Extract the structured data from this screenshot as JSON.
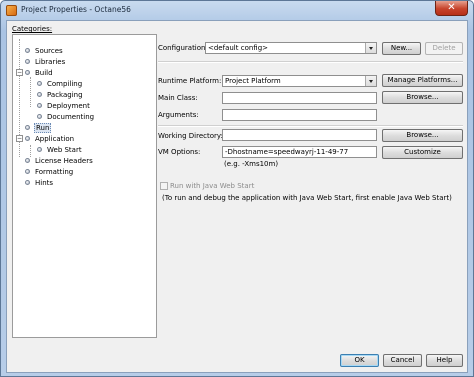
{
  "window": {
    "title": "Project Properties - Octane56",
    "close_glyph": "✕"
  },
  "categories": {
    "label": "Categories:",
    "items": [
      {
        "label": "Sources"
      },
      {
        "label": "Libraries"
      },
      {
        "label": "Build",
        "toggle": "−"
      },
      {
        "label": "Compiling"
      },
      {
        "label": "Packaging"
      },
      {
        "label": "Deployment"
      },
      {
        "label": "Documenting"
      },
      {
        "label": "Run",
        "selected": true
      },
      {
        "label": "Application",
        "toggle": "−"
      },
      {
        "label": "Web Start"
      },
      {
        "label": "License Headers"
      },
      {
        "label": "Formatting"
      },
      {
        "label": "Hints"
      }
    ]
  },
  "configuration": {
    "label": "Configuration:",
    "value": "<default config>",
    "new_button": "New...",
    "delete_button": "Delete"
  },
  "runtime_platform": {
    "label": "Runtime Platform:",
    "value": "Project Platform",
    "manage_button": "Manage Platforms..."
  },
  "main_class": {
    "label": "Main Class:",
    "value": "",
    "browse_button": "Browse..."
  },
  "arguments": {
    "label": "Arguments:",
    "value": ""
  },
  "working_directory": {
    "label": "Working Directory:",
    "value": "",
    "browse_button": "Browse..."
  },
  "vm_options": {
    "label": "VM Options:",
    "value": "-Dhostname=speedwayrj-11-49-77",
    "hint": "(e.g. -Xms10m)",
    "customize_button": "Customize"
  },
  "web_start": {
    "checkbox_label": "Run with Java Web Start",
    "note": "(To run and debug the application with Java Web Start, first enable Java Web Start)"
  },
  "footer": {
    "ok_button": "OK",
    "cancel_button": "Cancel",
    "help_button": "Help"
  }
}
